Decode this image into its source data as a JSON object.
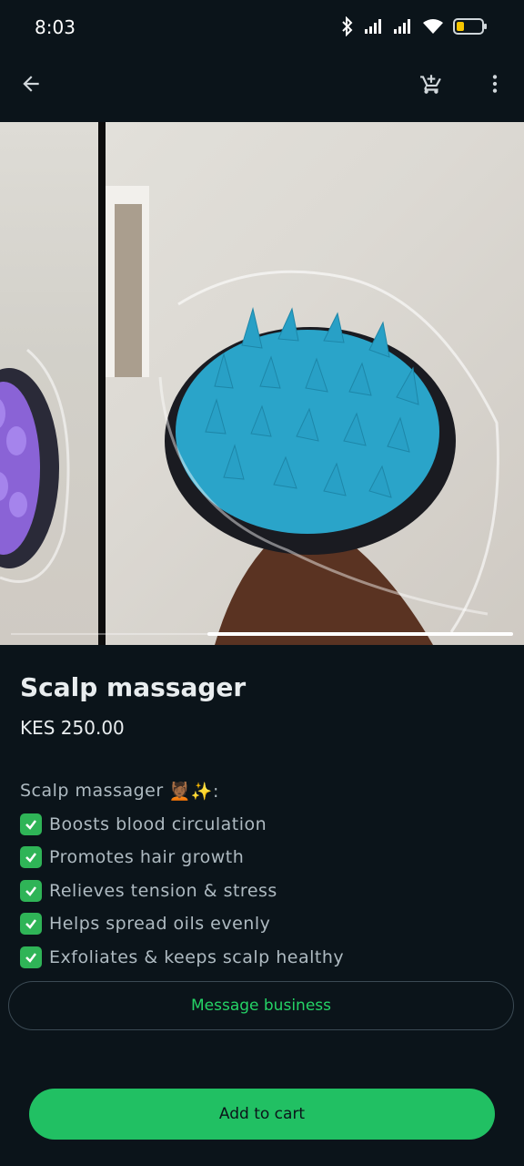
{
  "status_bar": {
    "time": "8:03",
    "icons": [
      "bluetooth-icon",
      "signal-icon",
      "signal-icon",
      "wifi-icon",
      "battery-icon"
    ],
    "battery_level": 0.2,
    "battery_color": "#f7c600"
  },
  "app_bar": {
    "icons": [
      "back-arrow-icon",
      "cart-icon",
      "more-vert-icon"
    ]
  },
  "gallery": {
    "image_count": 2,
    "active_index": 1
  },
  "product": {
    "title": "Scalp massager",
    "price": "KES 250.00",
    "description_intro": "Scalp massager",
    "intro_emojis": "💆🏾✨:",
    "features": [
      "Boosts blood circulation",
      "Promotes hair growth",
      "Relieves tension & stress",
      "Helps spread oils evenly",
      "Exfoliates & keeps scalp healthy"
    ]
  },
  "actions": {
    "message_label": "Message business",
    "add_to_cart_label": "Add to cart"
  },
  "colors": {
    "background": "#0b141a",
    "accent_green": "#21c063",
    "message_text": "#25d366",
    "check_green": "#2fb457"
  }
}
